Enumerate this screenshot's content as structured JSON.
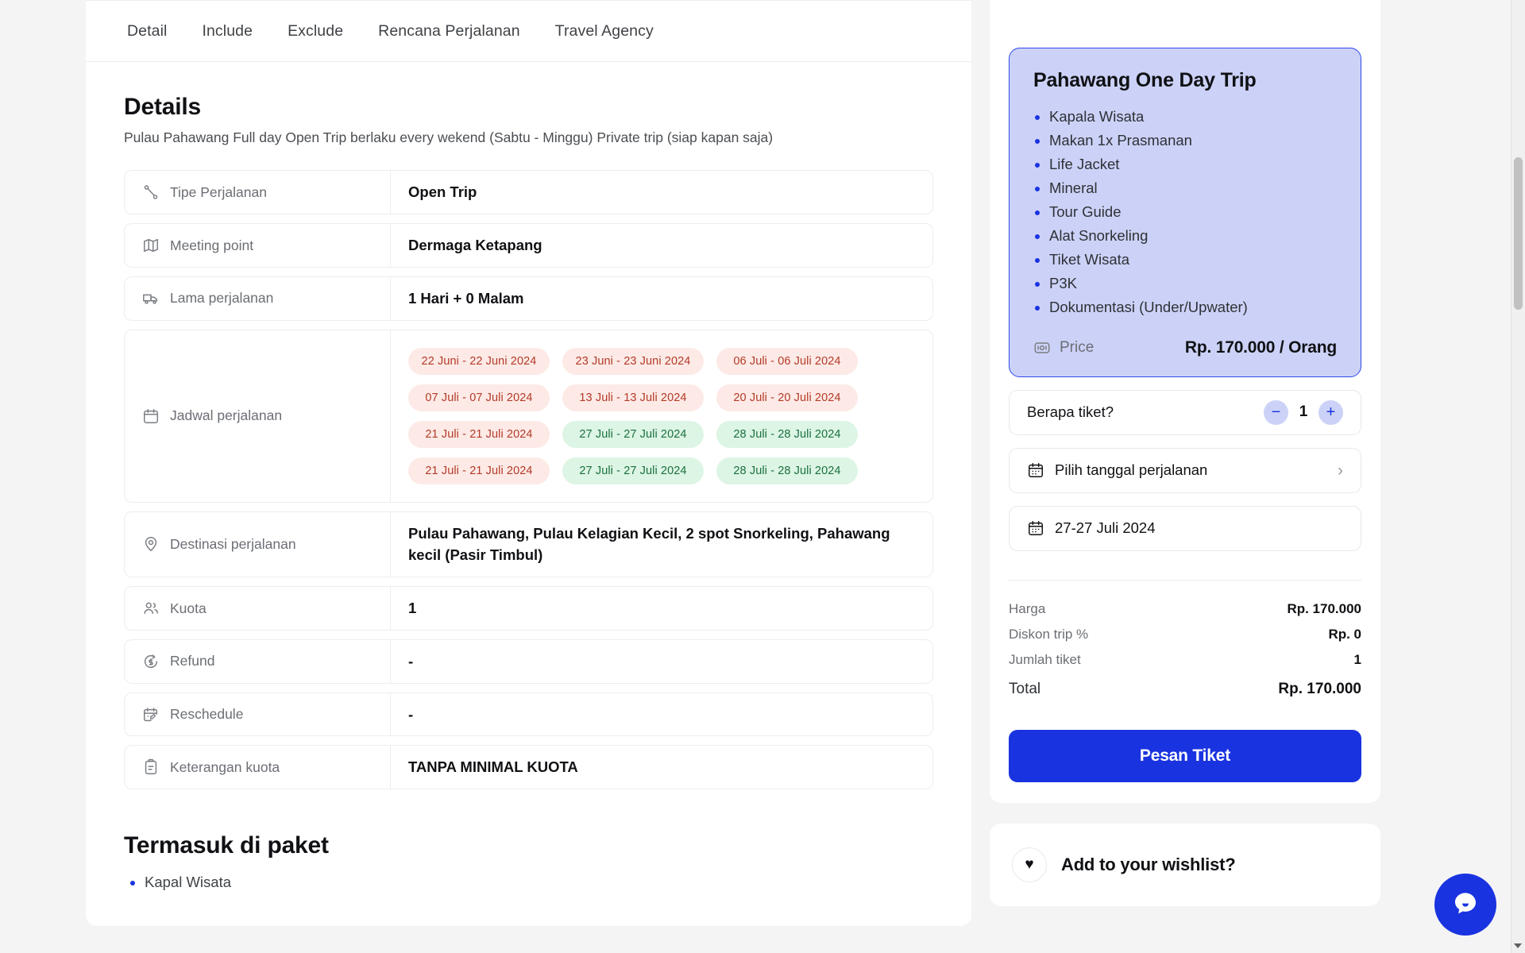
{
  "tabs": [
    {
      "label": "Detail",
      "name": "tab-detail"
    },
    {
      "label": "Include",
      "name": "tab-include"
    },
    {
      "label": "Exclude",
      "name": "tab-exclude"
    },
    {
      "label": "Rencana Perjalanan",
      "name": "tab-rencana-perjalanan"
    },
    {
      "label": "Travel Agency",
      "name": "tab-travel-agency"
    }
  ],
  "details": {
    "title": "Details",
    "subtitle": "Pulau Pahawang Full day Open Trip berlaku every wekend (Sabtu - Minggu) Private trip (siap kapan saja)",
    "rows": [
      {
        "label": "Tipe Perjalanan",
        "value": "Open Trip",
        "icon": "route-icon"
      },
      {
        "label": "Meeting point",
        "value": "Dermaga Ketapang",
        "icon": "map-icon"
      },
      {
        "label": "Lama perjalanan",
        "value": "1 Hari + 0 Malam",
        "icon": "truck-icon"
      },
      {
        "label": "Destinasi perjalanan",
        "value": "Pulau Pahawang, Pulau Kelagian Kecil, 2 spot Snorkeling, Pahawang kecil (Pasir Timbul)",
        "icon": "pin-icon"
      },
      {
        "label": "Kuota",
        "value": "1",
        "icon": "users-icon"
      },
      {
        "label": "Refund",
        "value": "-",
        "icon": "refund-icon"
      },
      {
        "label": "Reschedule",
        "value": "-",
        "icon": "calendar-edit-icon"
      },
      {
        "label": "Keterangan kuota",
        "value": "TANPA MINIMAL KUOTA",
        "icon": "clipboard-icon"
      }
    ],
    "schedule": {
      "label": "Jadwal perjalanan",
      "icon": "calendar-icon",
      "chips": [
        {
          "text": "22 Juni - 22 Juni 2024",
          "status": "red"
        },
        {
          "text": "23 Juni - 23 Juni 2024",
          "status": "red"
        },
        {
          "text": "06 Juli - 06 Juli 2024",
          "status": "red"
        },
        {
          "text": "07 Juli - 07 Juli 2024",
          "status": "red"
        },
        {
          "text": "13 Juli - 13 Juli 2024",
          "status": "red"
        },
        {
          "text": "20 Juli - 20 Juli 2024",
          "status": "red"
        },
        {
          "text": "21 Juli - 21 Juli 2024",
          "status": "red"
        },
        {
          "text": "27 Juli - 27 Juli 2024",
          "status": "green"
        },
        {
          "text": "28 Juli - 28 Juli 2024",
          "status": "green"
        },
        {
          "text": "21 Juli - 21 Juli 2024",
          "status": "red"
        },
        {
          "text": "27 Juli - 27 Juli 2024",
          "status": "green"
        },
        {
          "text": "28 Juli - 28 Juli 2024",
          "status": "green"
        }
      ]
    }
  },
  "included_section": {
    "title": "Termasuk di paket",
    "items": [
      "Kapal Wisata"
    ]
  },
  "booking": {
    "package": {
      "title": "Pahawang One Day Trip",
      "items": [
        "Kapala Wisata",
        "Makan 1x Prasmanan",
        "Life Jacket",
        "Mineral",
        "Tour Guide",
        "Alat Snorkeling",
        "Tiket Wisata",
        "P3K",
        "Dokumentasi (Under/Upwater)"
      ],
      "price_label": "Price",
      "price_value": "Rp. 170.000 / Orang",
      "price_icon": "money-icon",
      "border_color": "#2f47e8",
      "background_color": "#ccd2f7"
    },
    "ticket_counter": {
      "label": "Berapa tiket?",
      "count": "1",
      "decrement": "−",
      "increment": "+"
    },
    "date_picker": {
      "placeholder": "Pilih tanggal perjalanan",
      "icon": "calendar-icon",
      "chevron": "›"
    },
    "selected_date": {
      "value": "27-27 Juli 2024",
      "icon": "calendar-icon"
    },
    "summary": {
      "rows": [
        {
          "key": "Harga",
          "value": "Rp. 170.000"
        },
        {
          "key": "Diskon trip %",
          "value": "Rp. 0"
        },
        {
          "key": "Jumlah tiket",
          "value": "1"
        }
      ],
      "total_key": "Total",
      "total_value": "Rp. 170.000"
    },
    "cta_label": "Pesan Tiket",
    "accent_color": "#1a33e0"
  },
  "wishlist": {
    "label": "Add to your wishlist?",
    "icon": "heart-icon"
  },
  "chat": {
    "icon": "chat-bubble-icon"
  }
}
